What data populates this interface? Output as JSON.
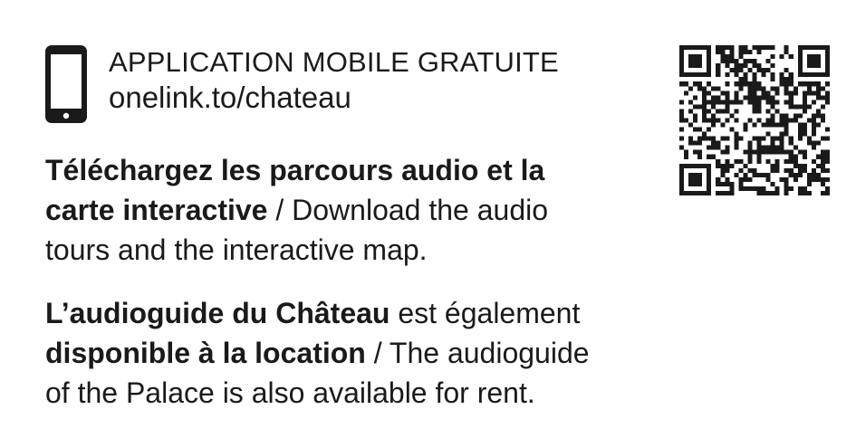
{
  "app": {
    "title": "APPLICATION MOBILE GRATUITE",
    "link": "onelink.to/chateau",
    "icon": "smartphone-icon",
    "qr_icon": "qr-code-icon"
  },
  "download": {
    "line1_bold": "Téléchargez les parcours audio et la",
    "line2_bold": "carte interactive",
    "line2_rest": " / Download the audio",
    "line3": "tours and the interactive map."
  },
  "audioguide": {
    "line1_bold": "L’audioguide du Château",
    "line1_rest": " est également",
    "line2_bold": "disponible à la location",
    "line2_rest": " / The audioguide",
    "line3": "of the Palace is also available for rent."
  },
  "colors": {
    "text": "#1a1a1a",
    "background": "#ffffff"
  }
}
